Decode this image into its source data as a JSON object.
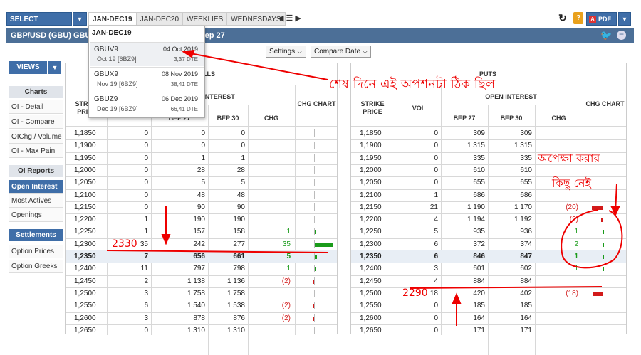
{
  "topbar": {
    "select_product": "SELECT PRODUCT",
    "tabs": [
      "JAN-DEC19",
      "JAN-DEC20",
      "WEEKLIES",
      "WEDNESDAYS"
    ],
    "pdf": "PDF"
  },
  "title": "GBP/USD (GBU) GBUV9 Open Interest (Bep 30) vs Bep 27",
  "toolbar": {
    "settings": "Settings",
    "compare_date": "Compare Date"
  },
  "sidebar": {
    "views": "VIEWS",
    "sections": [
      {
        "head": "Charts",
        "items": [
          "OI - Detail",
          "OI - Compare",
          "OIChg / Volume",
          "OI - Max Pain"
        ]
      },
      {
        "head": "OI Reports",
        "items": [
          "Open Interest",
          "Most Actives",
          "Openings"
        ]
      },
      {
        "head": "Settlements",
        "items": [
          "Option Prices",
          "Option Greeks"
        ]
      }
    ],
    "active_item": "Open Interest"
  },
  "dropdown": {
    "header": "JAN-DEC19",
    "items": [
      {
        "code": "GBUV9",
        "date": "04 Oct 2019",
        "sub": "Oct 19  [6BZ9]",
        "dte": "3,37 DTE"
      },
      {
        "code": "GBUX9",
        "date": "08 Nov 2019",
        "sub": "Nov 19  [6BZ9]",
        "dte": "38,41 DTE"
      },
      {
        "code": "GBUZ9",
        "date": "06 Dec 2019",
        "sub": "Dec 19  [6BZ9]",
        "dte": "66,41 DTE"
      }
    ]
  },
  "calls": {
    "title": "CALLS",
    "headers": {
      "strike": "STRIKE PRICE",
      "oi": "OPEN INTEREST",
      "bep27": "BEP 27",
      "bep30": "BEP 30",
      "chg": "CHG",
      "chart": "CHG CHART"
    },
    "rows": [
      {
        "strike": "1,1850",
        "vol": "0",
        "b27": "0",
        "b30": "0",
        "chg": ""
      },
      {
        "strike": "1,1900",
        "vol": "0",
        "b27": "0",
        "b30": "0",
        "chg": ""
      },
      {
        "strike": "1,1950",
        "vol": "0",
        "b27": "1",
        "b30": "1",
        "chg": ""
      },
      {
        "strike": "1,2000",
        "vol": "0",
        "b27": "28",
        "b30": "28",
        "chg": ""
      },
      {
        "strike": "1,2050",
        "vol": "0",
        "b27": "5",
        "b30": "5",
        "chg": ""
      },
      {
        "strike": "1,2100",
        "vol": "0",
        "b27": "48",
        "b30": "48",
        "chg": ""
      },
      {
        "strike": "1,2150",
        "vol": "0",
        "b27": "90",
        "b30": "90",
        "chg": ""
      },
      {
        "strike": "1,2200",
        "vol": "1",
        "b27": "190",
        "b30": "190",
        "chg": ""
      },
      {
        "strike": "1,2250",
        "vol": "1",
        "b27": "157",
        "b30": "158",
        "chg": "1"
      },
      {
        "strike": "1,2300",
        "vol": "35",
        "b27": "242",
        "b30": "277",
        "chg": "35"
      },
      {
        "strike": "1,2350",
        "vol": "7",
        "b27": "656",
        "b30": "661",
        "chg": "5"
      },
      {
        "strike": "1,2400",
        "vol": "11",
        "b27": "797",
        "b30": "798",
        "chg": "1"
      },
      {
        "strike": "1,2450",
        "vol": "2",
        "b27": "1 138",
        "b30": "1 136",
        "chg": "(2)"
      },
      {
        "strike": "1,2500",
        "vol": "3",
        "b27": "1 758",
        "b30": "1 758",
        "chg": ""
      },
      {
        "strike": "1,2550",
        "vol": "6",
        "b27": "1 540",
        "b30": "1 538",
        "chg": "(2)"
      },
      {
        "strike": "1,2600",
        "vol": "3",
        "b27": "878",
        "b30": "876",
        "chg": "(2)"
      },
      {
        "strike": "1,2650",
        "vol": "0",
        "b27": "1 310",
        "b30": "1 310",
        "chg": ""
      }
    ]
  },
  "puts": {
    "title": "PUTS",
    "headers": {
      "strike": "STRIKE PRICE",
      "vol": "VOL",
      "oi": "OPEN INTEREST",
      "bep27": "BEP 27",
      "bep30": "BEP 30",
      "chg": "CHG",
      "chart": "CHG CHART"
    },
    "rows": [
      {
        "strike": "1,1850",
        "vol": "0",
        "b27": "309",
        "b30": "309",
        "chg": ""
      },
      {
        "strike": "1,1900",
        "vol": "0",
        "b27": "1 315",
        "b30": "1 315",
        "chg": ""
      },
      {
        "strike": "1,1950",
        "vol": "0",
        "b27": "335",
        "b30": "335",
        "chg": ""
      },
      {
        "strike": "1,2000",
        "vol": "0",
        "b27": "610",
        "b30": "610",
        "chg": ""
      },
      {
        "strike": "1,2050",
        "vol": "0",
        "b27": "655",
        "b30": "655",
        "chg": ""
      },
      {
        "strike": "1,2100",
        "vol": "1",
        "b27": "686",
        "b30": "686",
        "chg": ""
      },
      {
        "strike": "1,2150",
        "vol": "21",
        "b27": "1 190",
        "b30": "1 170",
        "chg": "(20)"
      },
      {
        "strike": "1,2200",
        "vol": "4",
        "b27": "1 194",
        "b30": "1 192",
        "chg": "(2)"
      },
      {
        "strike": "1,2250",
        "vol": "5",
        "b27": "935",
        "b30": "936",
        "chg": "1"
      },
      {
        "strike": "1,2300",
        "vol": "6",
        "b27": "372",
        "b30": "374",
        "chg": "2"
      },
      {
        "strike": "1,2350",
        "vol": "6",
        "b27": "846",
        "b30": "847",
        "chg": "1"
      },
      {
        "strike": "1,2400",
        "vol": "3",
        "b27": "601",
        "b30": "602",
        "chg": "1"
      },
      {
        "strike": "1,2450",
        "vol": "4",
        "b27": "884",
        "b30": "884",
        "chg": ""
      },
      {
        "strike": "1,2500",
        "vol": "18",
        "b27": "420",
        "b30": "402",
        "chg": "(18)"
      },
      {
        "strike": "1,2550",
        "vol": "0",
        "b27": "185",
        "b30": "185",
        "chg": ""
      },
      {
        "strike": "1,2600",
        "vol": "0",
        "b27": "164",
        "b30": "164",
        "chg": ""
      },
      {
        "strike": "1,2650",
        "vol": "0",
        "b27": "171",
        "b30": "171",
        "chg": ""
      }
    ]
  },
  "annotations": {
    "top_note": "শেষ দিনে এই অপশনটা ঠিক ছিল",
    "note2_line1": "অপেক্ষা করার",
    "note2_line2": "কিছু নেই",
    "label_2330": "2330",
    "label_2290": "2290"
  }
}
